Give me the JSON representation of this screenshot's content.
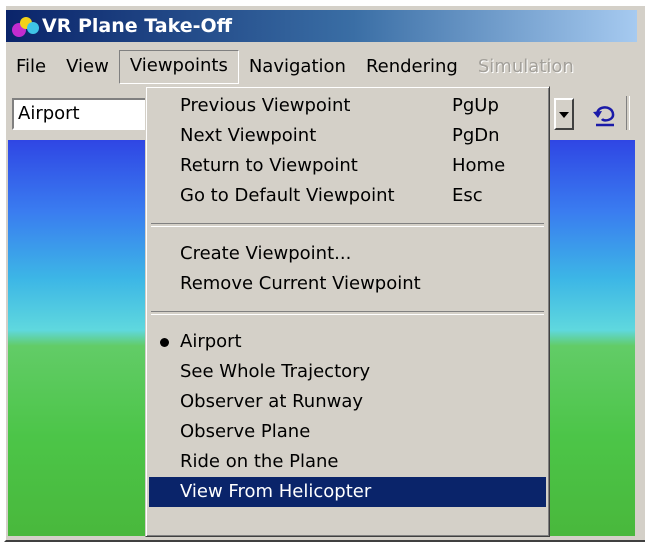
{
  "window": {
    "title": "VR Plane Take-Off"
  },
  "menubar": {
    "items": [
      {
        "label": "File",
        "state": "normal"
      },
      {
        "label": "View",
        "state": "normal"
      },
      {
        "label": "Viewpoints",
        "state": "open"
      },
      {
        "label": "Navigation",
        "state": "normal"
      },
      {
        "label": "Rendering",
        "state": "normal"
      },
      {
        "label": "Simulation",
        "state": "disabled"
      }
    ]
  },
  "toolbar": {
    "viewpoint_select_value": "Airport",
    "undo_icon": "undo-icon"
  },
  "viewpoints_menu": {
    "navigation_group": [
      {
        "label": "Previous Viewpoint",
        "shortcut": "PgUp"
      },
      {
        "label": "Next Viewpoint",
        "shortcut": "PgDn"
      },
      {
        "label": "Return to Viewpoint",
        "shortcut": "Home"
      },
      {
        "label": "Go to Default Viewpoint",
        "shortcut": "Esc"
      }
    ],
    "edit_group": [
      {
        "label": "Create Viewpoint..."
      },
      {
        "label": "Remove Current Viewpoint"
      }
    ],
    "viewpoint_list": [
      {
        "label": "Airport",
        "checked": true
      },
      {
        "label": "See Whole Trajectory",
        "checked": false
      },
      {
        "label": "Observer at Runway",
        "checked": false
      },
      {
        "label": "Observe Plane",
        "checked": false
      },
      {
        "label": "Ride on the Plane",
        "checked": false
      },
      {
        "label": "View From Helicopter",
        "checked": false,
        "highlighted": true
      }
    ]
  },
  "colors": {
    "title_bar": "#0a246a",
    "menu_highlight": "#0a246a",
    "sky": "#3cb6e6",
    "ground": "#4cc548"
  }
}
